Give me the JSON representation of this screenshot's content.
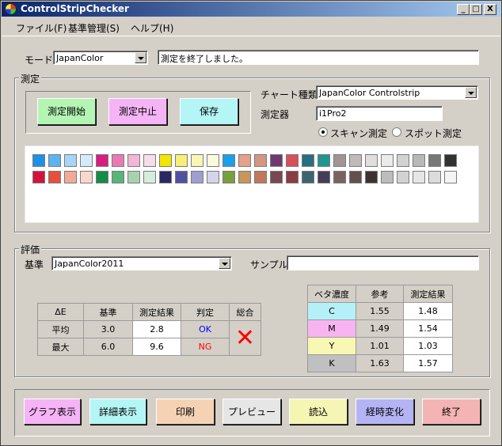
{
  "window": {
    "title": "ControlStripChecker",
    "minimize": "_",
    "maximize": "□",
    "close": "X"
  },
  "menu": [
    {
      "label": "ファイル(F)"
    },
    {
      "label": "基準管理(S)"
    },
    {
      "label": "ヘルプ(H)"
    }
  ],
  "mode": {
    "label": "モード",
    "value": "JapanColor",
    "status": "測定を終了しました。"
  },
  "measure": {
    "group_title": "測定",
    "start_label": "測定開始",
    "stop_label": "測定中止",
    "save_label": "保存",
    "chart_label": "チャート種類",
    "chart_value": "JapanColor Controlstrip",
    "device_label": "測定器",
    "device_value": "i1Pro2",
    "scan_label": "スキャン測定",
    "spot_label": "スポット測定",
    "scan_selected": true,
    "patch_colors": [
      [
        "#1e90e6",
        "#5ab4f0",
        "#a8d4f5",
        "#d6ebfa",
        "#d81e82",
        "#e87ab4",
        "#f2b6d6",
        "#f8dcea",
        "#f5e600",
        "#f7ef78",
        "#faf6b4",
        "#fcfadc",
        "#1aa0e6",
        "#e6a08c",
        "#d29682",
        "#6e3a6e",
        "#d8505a",
        "#286e82",
        "#1e9690",
        "#a09494",
        "#c0baba",
        "#e2dede",
        "#ecebeb",
        "#d2d2d2",
        "#b8b8b8",
        "#787878",
        "#323232"
      ],
      [
        "#d2143c",
        "#e6503c",
        "#f0aa96",
        "#f8d8cc",
        "#148c46",
        "#5ab478",
        "#a6d2b0",
        "#d6ecdc",
        "#282864",
        "#5050a0",
        "#9e9ed2",
        "#d4d4ec",
        "#78a03c",
        "#c8965a",
        "#c0785a",
        "#784850",
        "#8c3c46",
        "#3c646e",
        "#463c5a",
        "#7a6262",
        "#645050",
        "#3c3232",
        "#bcbcbc",
        "#d2d2d2",
        "#e6e6e6",
        "#dcdcdc",
        "#f4f4f4"
      ]
    ]
  },
  "evaluation": {
    "group_title": "評価",
    "standard_label": "基準",
    "standard_value": "JapanColor2011",
    "sample_label": "サンプル",
    "sample_value": "",
    "delta_table": {
      "headers": [
        "ΔE",
        "基準",
        "測定結果",
        "判定",
        "総合"
      ],
      "rows": [
        {
          "name": "平均",
          "standard": "3.0",
          "result": "2.8",
          "judge": "OK"
        },
        {
          "name": "最大",
          "standard": "6.0",
          "result": "9.6",
          "judge": "NG"
        }
      ],
      "overall": "✕"
    },
    "density_table": {
      "headers": [
        "ベタ濃度",
        "参考",
        "測定結果"
      ],
      "rows": [
        {
          "ink": "C",
          "ref": "1.55",
          "result": "1.48",
          "color": "#b4f0f8"
        },
        {
          "ink": "M",
          "ref": "1.49",
          "result": "1.54",
          "color": "#f8b4f0"
        },
        {
          "ink": "Y",
          "ref": "1.01",
          "result": "1.03",
          "color": "#f8f8b4"
        },
        {
          "ink": "K",
          "ref": "1.63",
          "result": "1.57",
          "color": "#c0c0c0"
        }
      ]
    }
  },
  "bottom_buttons": [
    {
      "label": "グラフ表示",
      "color": "#f5b4f5"
    },
    {
      "label": "詳細表示",
      "color": "#b4f5f5"
    },
    {
      "label": "印刷",
      "color": "#f5d2b4"
    },
    {
      "label": "プレビュー",
      "color": "#e6e6e6"
    },
    {
      "label": "読込",
      "color": "#f5f5b4"
    },
    {
      "label": "経時変化",
      "color": "#b4b4f5"
    },
    {
      "label": "終了",
      "color": "#f5b4b4"
    }
  ],
  "colors": {
    "ok": "#0000ff",
    "ng": "#ff0000",
    "cross": "#ff0000"
  }
}
